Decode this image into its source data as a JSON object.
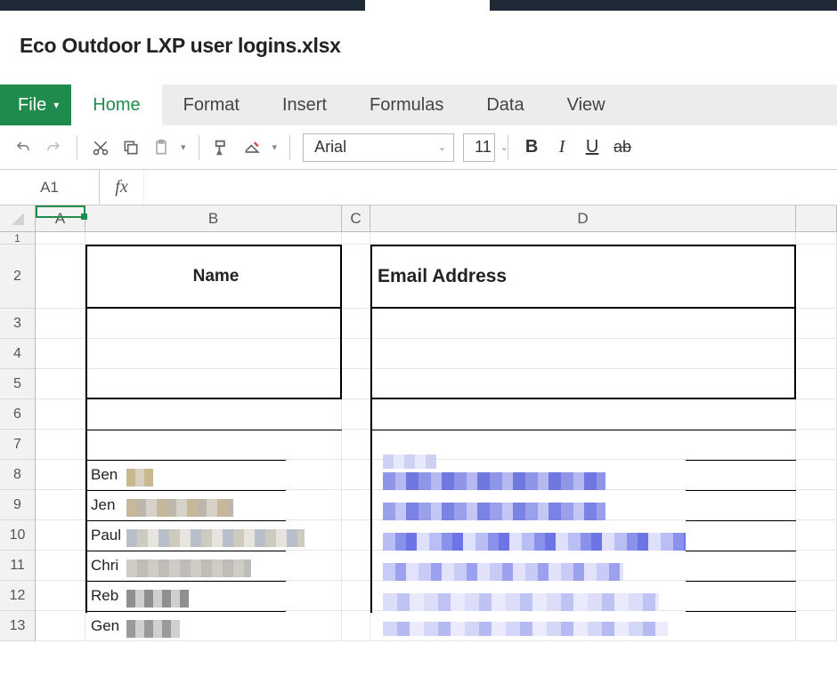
{
  "document": {
    "filename": "Eco Outdoor LXP user logins.xlsx"
  },
  "tabs": {
    "file": "File",
    "home": "Home",
    "format": "Format",
    "insert": "Insert",
    "formulas": "Formulas",
    "data": "Data",
    "view": "View"
  },
  "toolbar": {
    "font_name": "Arial",
    "font_size": "11",
    "bold": "B",
    "italic": "I",
    "underline": "U",
    "strike": "ab"
  },
  "cellref": "A1",
  "fx_label": "fx",
  "columns": {
    "A": "A",
    "B": "B",
    "C": "C",
    "D": "D"
  },
  "headers": {
    "name": "Name",
    "email": "Email Address"
  },
  "rows": {
    "r1": "1",
    "r2": "2",
    "r3": "3",
    "r4": "4",
    "r5": "5",
    "r6": "6",
    "r7": "7",
    "r8": "8",
    "r9": "9",
    "r10": "10",
    "r11": "11",
    "r12": "12",
    "r13": "13"
  },
  "data": {
    "r8": {
      "name": "Ben"
    },
    "r9": {
      "name": "Jen"
    },
    "r10": {
      "name": "Paul"
    },
    "r11": {
      "name": "Chri"
    },
    "r12": {
      "name": "Reb"
    },
    "r13": {
      "name": "Gen"
    }
  }
}
